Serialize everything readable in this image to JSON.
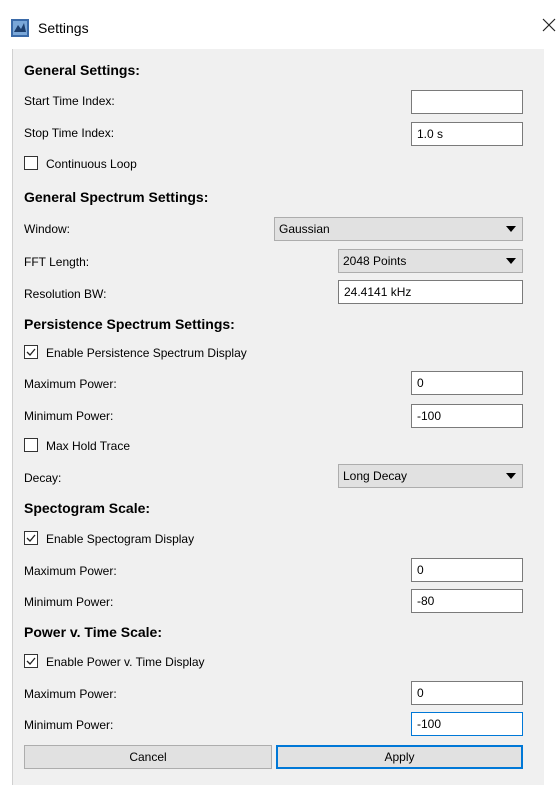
{
  "window": {
    "title": "Settings"
  },
  "general": {
    "heading": "General Settings:",
    "start_label": "Start Time Index:",
    "start_value": "",
    "stop_label": "Stop Time Index:",
    "stop_value": "1.0 s",
    "loop_label": "Continuous Loop",
    "loop_checked": false
  },
  "spectrum": {
    "heading": "General Spectrum Settings:",
    "window_label": "Window:",
    "window_value": "Gaussian",
    "fft_label": "FFT Length:",
    "fft_value": "2048 Points",
    "rbw_label": "Resolution BW:",
    "rbw_value": "24.4141 kHz"
  },
  "persistence": {
    "heading": "Persistence Spectrum Settings:",
    "enable_label": "Enable Persistence Spectrum Display",
    "enable_checked": true,
    "max_label": "Maximum Power:",
    "max_value": "0",
    "min_label": "Minimum Power:",
    "min_value": "-100",
    "maxhold_label": "Max Hold Trace",
    "maxhold_checked": false,
    "decay_label": "Decay:",
    "decay_value": "Long Decay"
  },
  "spectrogram": {
    "heading": "Spectogram Scale:",
    "enable_label": "Enable Spectogram Display",
    "enable_checked": true,
    "max_label": "Maximum Power:",
    "max_value": "0",
    "min_label": "Minimum Power:",
    "min_value": "-80"
  },
  "power_time": {
    "heading": "Power v. Time Scale:",
    "enable_label": "Enable Power v. Time Display",
    "enable_checked": true,
    "max_label": "Maximum Power:",
    "max_value": "0",
    "min_label": "Minimum Power:",
    "min_value": "-100"
  },
  "buttons": {
    "cancel": "Cancel",
    "apply": "Apply"
  },
  "colors": {
    "accent": "#0078d7",
    "panel": "#f0f0f0",
    "control": "#e1e1e1"
  }
}
